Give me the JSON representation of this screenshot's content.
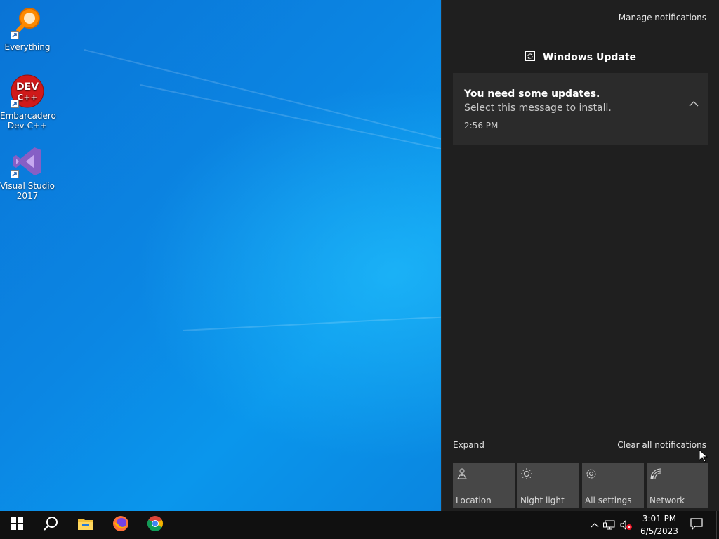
{
  "desktop": {
    "icons": [
      {
        "label": "Everything",
        "icon": "everything-search-icon"
      },
      {
        "label": "Embarcadero Dev-C++",
        "icon": "dev-cpp-icon",
        "badge": "DEV\nC++"
      },
      {
        "label": "Visual Studio 2017",
        "icon": "visual-studio-icon"
      }
    ]
  },
  "action_center": {
    "manage_label": "Manage notifications",
    "group_title": "Windows Update",
    "notification": {
      "headline": "You need some updates.",
      "body": "Select this message to install.",
      "time": "2:56 PM"
    },
    "expand_label": "Expand",
    "clear_label": "Clear all notifications",
    "quick_actions": [
      {
        "label": "Location",
        "icon": "location-icon"
      },
      {
        "label": "Night light",
        "icon": "night-light-icon"
      },
      {
        "label": "All settings",
        "icon": "settings-gear-icon"
      },
      {
        "label": "Network",
        "icon": "network-icon"
      }
    ]
  },
  "taskbar": {
    "clock_time": "3:01 PM",
    "clock_date": "6/5/2023",
    "apps": [
      "start-windows-icon",
      "search-icon",
      "file-explorer-icon",
      "firefox-icon",
      "chrome-icon"
    ],
    "tray": [
      "show-hidden-icons-chevron",
      "network-tray-icon",
      "volume-muted-icon",
      "notifications-icon"
    ]
  },
  "colors": {
    "action_center_bg": "#1f1f1f",
    "card_bg": "#2b2b2b",
    "tile_bg": "#474747",
    "taskbar_bg": "#101010"
  }
}
